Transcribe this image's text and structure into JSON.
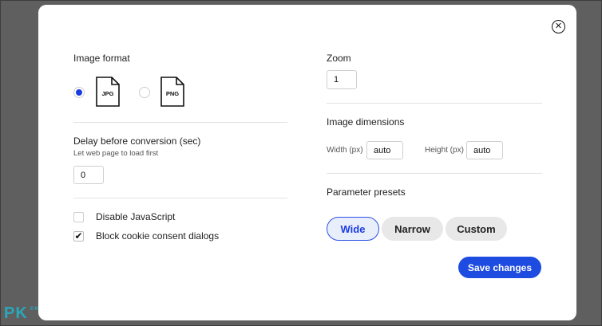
{
  "left": {
    "image_format_label": "Image format",
    "formats": [
      {
        "label": "JPG",
        "selected": true
      },
      {
        "label": "PNG",
        "selected": false
      }
    ],
    "delay_label": "Delay before conversion (sec)",
    "delay_hint": "Let web page to load first",
    "delay_value": "0",
    "disable_js_label": "Disable JavaScript",
    "disable_js_checked": false,
    "block_cookie_label": "Block cookie consent dialogs",
    "block_cookie_checked": true,
    "check_glyph": "✔"
  },
  "right": {
    "zoom_label": "Zoom",
    "zoom_value": "1",
    "dimensions_label": "Image dimensions",
    "width_label": "Width (px)",
    "width_value": "auto",
    "height_label": "Height (px)",
    "height_value": "auto",
    "presets_label": "Parameter presets",
    "presets": [
      "Wide",
      "Narrow",
      "Custom"
    ],
    "active_preset": "Wide"
  },
  "save_label": "Save changes",
  "close_glyph": "✕",
  "watermark": {
    "text": "PK",
    "suffix": "ce"
  },
  "colors": {
    "accent": "#1e4be0",
    "overlay": "#5f5f5f",
    "watermark": "#2aa7b8"
  }
}
